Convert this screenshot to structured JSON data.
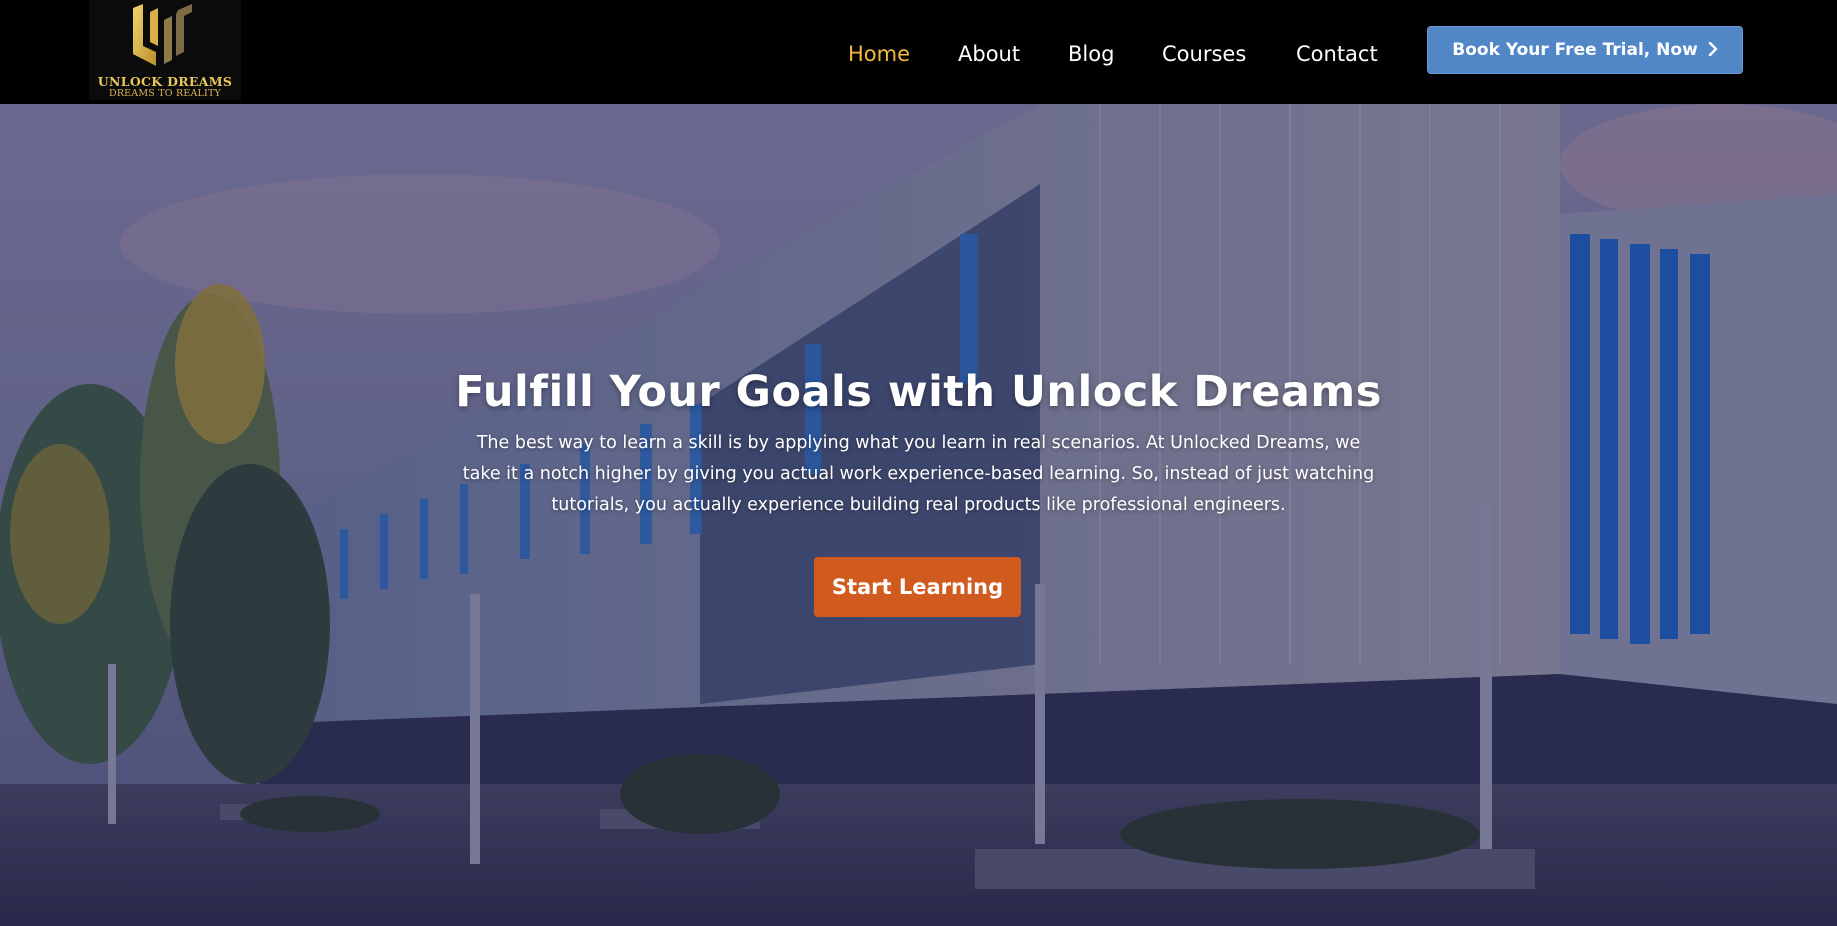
{
  "brand": {
    "name": "UNLOCK DREAMS",
    "tagline": "DREAMS TO REALITY",
    "logo_icon": "unlock-dreams-logo-icon",
    "logo_color": "#e9c65b"
  },
  "nav": {
    "items": [
      {
        "label": "Home",
        "active": true
      },
      {
        "label": "About",
        "active": false
      },
      {
        "label": "Blog",
        "active": false
      },
      {
        "label": "Courses",
        "active": false
      },
      {
        "label": "Contact",
        "active": false
      }
    ],
    "cta_label": "Book Your Free Trial, Now",
    "cta_icon": "chevron-right-icon",
    "active_color": "#f4b841",
    "cta_color": "#5186c7"
  },
  "hero": {
    "title": "Fulfill Your Goals with Unlock Dreams",
    "text": "The best way to learn a skill is by applying what you learn in real scenarios. At Unlocked Dreams, we take it a notch higher by giving you actual work experience-based learning. So, instead of just watching tutorials, you actually experience building real products like professional engineers.",
    "button_label": "Start Learning",
    "button_color": "#d15a1e",
    "background_image": "campus-building-photo"
  }
}
